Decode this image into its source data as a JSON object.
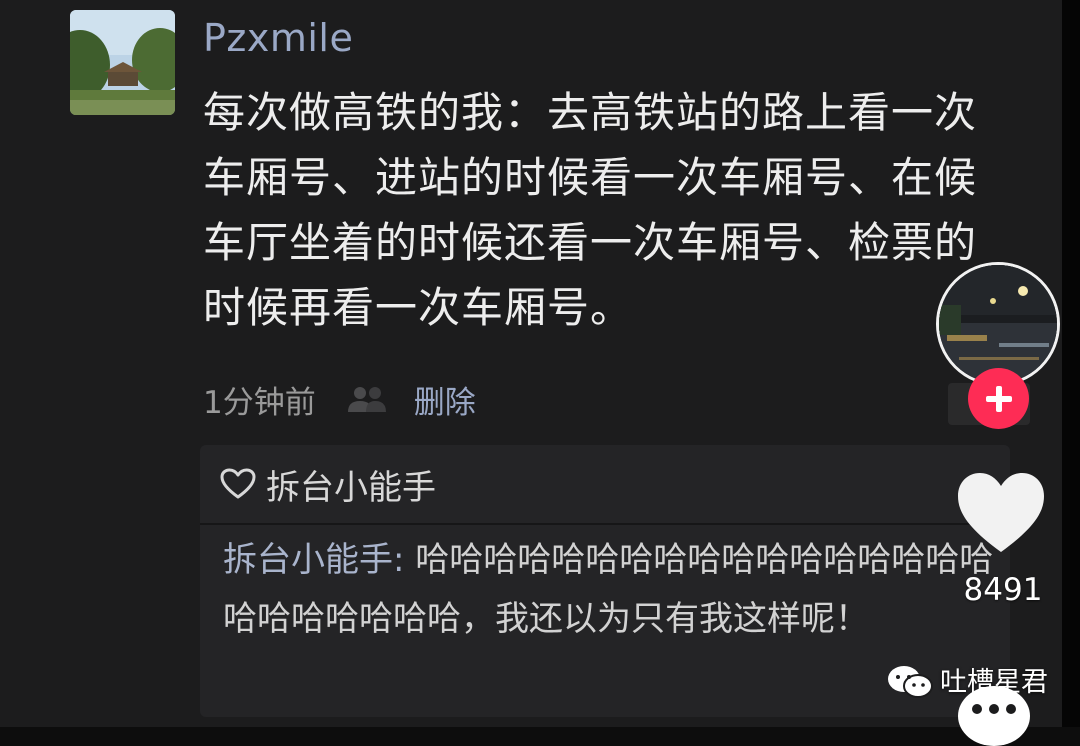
{
  "comment": {
    "username": "Pzxmile",
    "text": "每次做高铁的我：去高铁站的路上看一次车厢号、进站的时候看一次车厢号、在候车厅坐着的时候还看一次车厢号、检票的时候再看一次车厢号。",
    "time": "1分钟前",
    "delete_label": "删除"
  },
  "quote": {
    "header_name": "拆台小能手",
    "author": "拆台小能手:",
    "text": " 哈哈哈哈哈哈哈哈哈哈哈哈哈哈哈哈哈哈哈哈哈哈哈哈，我还以为只有我这样呢！"
  },
  "sidebar": {
    "like_count": "8491",
    "watermark": "吐槽星君"
  },
  "colors": {
    "username": "#9aa8c6",
    "follow_button": "#fe2c55",
    "panel_bg": "#1c1c1d"
  },
  "icons": {
    "people": "people-icon",
    "heart_outline": "heart-outline-icon",
    "like": "heart-icon",
    "follow": "plus-icon",
    "wechat": "wechat-icon"
  }
}
